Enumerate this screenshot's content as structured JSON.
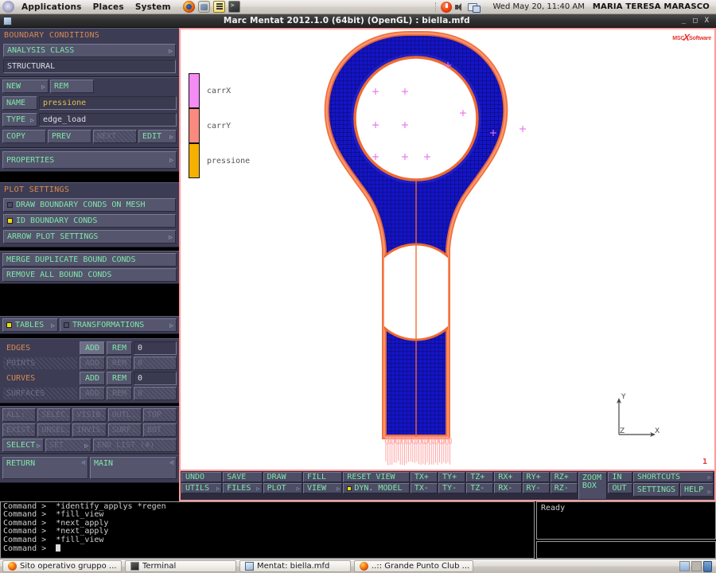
{
  "desktop": {
    "menus": [
      "Applications",
      "Places",
      "System"
    ],
    "launchers": [
      "firefox-icon",
      "gnome-globe-icon",
      "text-editor-icon",
      "terminal-icon"
    ],
    "tray": [
      "update-manager-icon",
      "volume-icon",
      "network-icon"
    ],
    "clock": "Wed May 20, 11:40 AM",
    "user": "MARIA TERESA MARASCO"
  },
  "window": {
    "title": "Marc Mentat 2012.1.0 (64bit) (OpenGL) : biella.mfd",
    "minimize": "_",
    "maximize": "□",
    "close": "X"
  },
  "sidebar": {
    "title": "BOUNDARY CONDITIONS",
    "analysis_class": {
      "button": "ANALYSIS CLASS",
      "value": "STRUCTURAL"
    },
    "bc_controls": {
      "new": "NEW",
      "rem": "REM",
      "name_label": "NAME",
      "name_value": "pressione",
      "type_label": "TYPE",
      "type_value": "edge_load",
      "copy": "COPY",
      "prev": "PREV",
      "next": "NEXT",
      "edit": "EDIT"
    },
    "properties": "PROPERTIES",
    "plot_settings": {
      "title": "PLOT SETTINGS",
      "draw_on_mesh": "DRAW BOUNDARY CONDS ON MESH",
      "draw_on_mesh_checked": false,
      "id_bound_conds": "ID BOUNDARY CONDS",
      "id_bound_conds_checked": true,
      "arrow_plot_settings": "ARROW PLOT SETTINGS"
    },
    "merge_duplicate": "MERGE DUPLICATE BOUND CONDS",
    "remove_all": "REMOVE ALL BOUND CONDS",
    "tables": "TABLES",
    "tables_checked": true,
    "transformations": "TRANSFORMATIONS",
    "transformations_checked": false,
    "entities": [
      {
        "label": "EDGES",
        "add": "ADD",
        "rem": "REM",
        "count": "0",
        "enabled": true,
        "hover": true
      },
      {
        "label": "POINTS",
        "add": "ADD",
        "rem": "REM",
        "count": "0",
        "enabled": false,
        "hover": false
      },
      {
        "label": "CURVES",
        "add": "ADD",
        "rem": "REM",
        "count": "0",
        "enabled": true,
        "hover": false
      },
      {
        "label": "SURFACES",
        "add": "ADD",
        "rem": "REM",
        "count": "0",
        "enabled": false,
        "hover": false
      }
    ],
    "select_row1": [
      "ALL:",
      "SELEC.",
      "VISIB.",
      "OUTL.",
      "TOP"
    ],
    "select_row2": [
      "EXIST.",
      "UNSEL.",
      "INVIS.",
      "SURF.",
      "BOT"
    ],
    "select": "SELECT",
    "set": "SET",
    "end_list": "END LIST (#)",
    "return": "RETURN",
    "main": "MAIN"
  },
  "viewport": {
    "logo": "MSC",
    "logo2": "Software",
    "view_number": "1",
    "legend": [
      {
        "label": "carrX",
        "color": "#f58bf5"
      },
      {
        "label": "carrY",
        "color": "#fa8a7e"
      },
      {
        "label": "pressione",
        "color": "#f5b000"
      }
    ],
    "axes": {
      "x": "X",
      "y": "Y",
      "z": "Z"
    }
  },
  "toolbar": {
    "row1": [
      "UNDO",
      "SAVE",
      "DRAW",
      "FILL",
      "RESET VIEW",
      "TX+",
      "TY+",
      "TZ+",
      "RX+",
      "RY+",
      "RZ+"
    ],
    "row2": [
      "UTILS",
      "FILES",
      "PLOT",
      "VIEW",
      "DYN. MODEL",
      "TX-",
      "TY-",
      "TZ-",
      "RX-",
      "RY-",
      "RZ-"
    ],
    "dyn_model_checked": true,
    "zoom_box": "ZOOM BOX",
    "in": "IN",
    "out": "OUT",
    "shortcuts": "SHORTCUTS",
    "settings": "SETTINGS",
    "help": "HELP"
  },
  "console": {
    "lines": [
      "Command >  *identify_applys *regen",
      "Command >  *fill_view",
      "Command >  *next_apply",
      "Command >  *next_apply",
      "Command >  *fill_view"
    ],
    "prompt": "Command >  ",
    "status": "Ready"
  },
  "taskbar": {
    "tasks": [
      {
        "icon": "firefox",
        "label": "Sito operativo gruppo ..."
      },
      {
        "icon": "term",
        "label": "Terminal"
      },
      {
        "icon": "mentat",
        "label": "Mentat: biella.mfd"
      },
      {
        "icon": "firefox",
        "label": "..:: Grande Punto Club ..."
      }
    ]
  }
}
